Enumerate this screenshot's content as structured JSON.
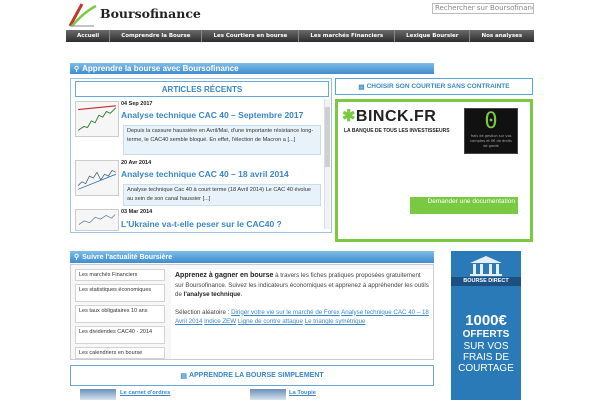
{
  "header": {
    "site_name": "Boursofinance",
    "search_placeholder": "Rechercher sur Boursofinance"
  },
  "nav": {
    "items": [
      "Accueil",
      "Comprendre la Bourse",
      "Les Courtiers en bourse",
      "Les marchés Financiers",
      "Lexique Boursier",
      "Nos analyses"
    ]
  },
  "banner_learn": "Apprendre la bourse avec Boursofinance",
  "articles": {
    "title": "ARTICLES RÉCENTS",
    "items": [
      {
        "date": "04 Sep 2017",
        "title": "Analyse technique CAC 40 – Septembre 2017",
        "excerpt": "Depuis la cassure haussière en Avril/Mai, d'une importante résistance long-terme, le CAC40 semble bloqué. En effet, l'élection de Macron a [...]"
      },
      {
        "date": "20 Avr 2014",
        "title": "Analyse technique CAC 40 – 18 avril 2014",
        "excerpt": "Analyse technique Cac 40 à court terme (18 Avril 2014) Le CAC 40 évolue au sein de son canal haussier [...]"
      },
      {
        "date": "03 Mar 2014",
        "title": "L'Ukraine va-t-elle peser sur le CAC40 ?",
        "excerpt": ""
      }
    ]
  },
  "broker": {
    "button_label": "CHOISIR SON COURTIER SANS CONTRAINTE",
    "ad_logo": "BINCK.FR",
    "ad_tagline": "LA BANQUE DE TOUS LES INVESTISSEURS",
    "ad_zero": "0",
    "ad_zero_text": "frais de gestion sur vos comptes et 0€ de droits de garde",
    "ad_button": "Demander une documentation"
  },
  "follow": {
    "title": "Suivre l'actualité Boursière",
    "links": [
      "Les marchés Financiers",
      "Les statistiques économiques",
      "Les taux obligataires 10 ans",
      "Les dividendes CAC40 - 2014",
      "Les calendriers en bourse"
    ],
    "intro_bold": "Apprenez à gagner en bourse",
    "intro_rest": " à travers les fiches pratiques proposées gratuitement sur Boursofinance. Suivez les indicateurs économiques et apprenez à appréhender les outils de ",
    "intro_tail": "l'analyse technique",
    "intro_end": ".",
    "random_label": "Sélection aléatoire : ",
    "random_links": [
      "Diriger votre vie sur le marché de Forex",
      "Analyse technique CAC 40 – 18 Avril 2014",
      "Indice ZEW",
      "Ligne de contre attaque",
      "Le triangle symétrique"
    ]
  },
  "simple": {
    "button_label": "APPRENDRE LA BOURSE SIMPLEMENT"
  },
  "bottom_links": [
    "Le carnet d'ordres",
    "La Toupie"
  ],
  "bd_ad": {
    "brand": "BOURSE DIRECT",
    "offer_amount": "1000€",
    "offer_word": "OFFERTS",
    "offer_sub": "SUR VOS FRAIS DE COURTAGE"
  },
  "colors": {
    "accent": "#3a86c8",
    "ad_green": "#7ac943",
    "nav_dark": "#2e2e2e"
  }
}
